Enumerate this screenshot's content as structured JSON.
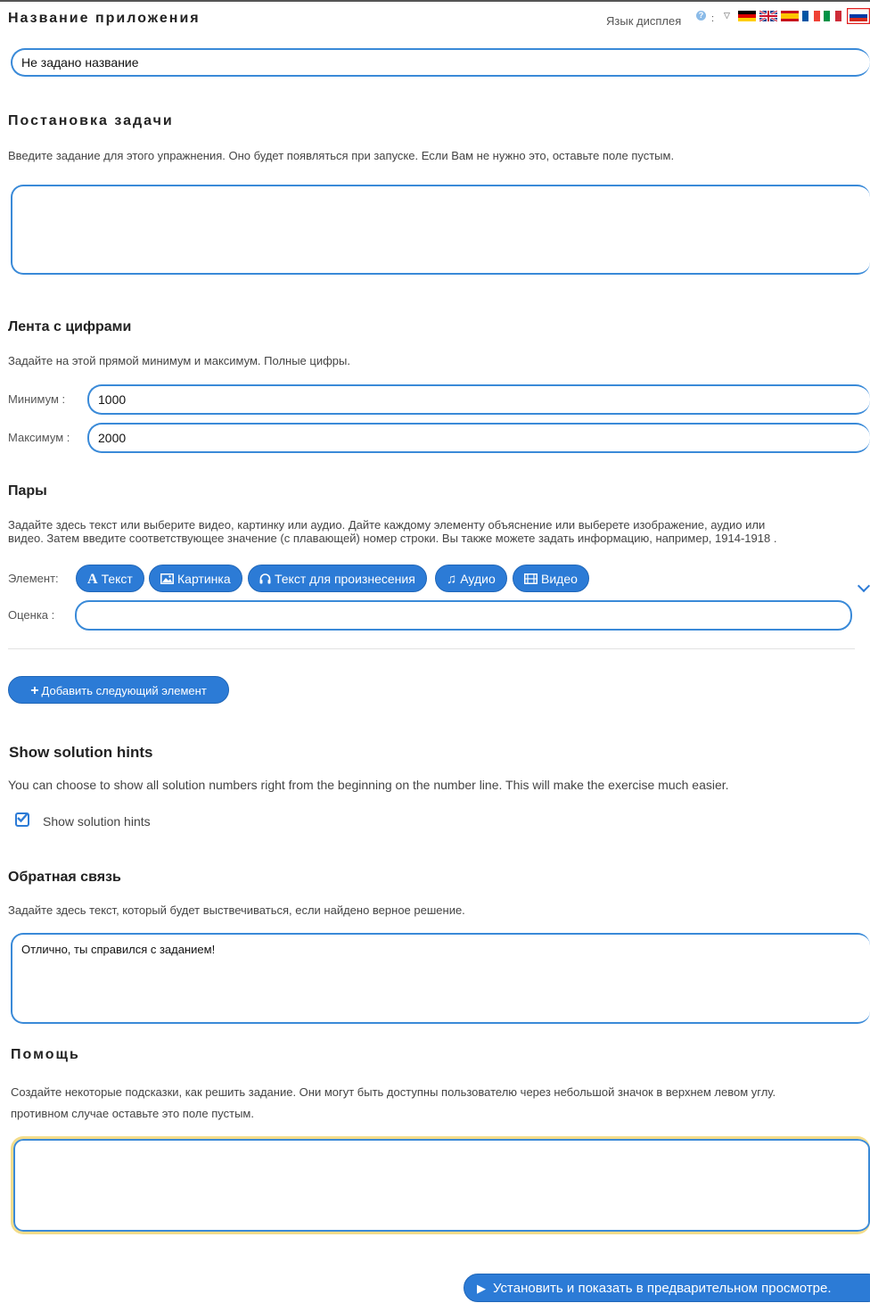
{
  "app_name": {
    "heading": "Название приложения",
    "value": "Не задано название",
    "display_language_label": "Язык дисплея",
    "help_icon": "?",
    "flags": [
      "de",
      "gb",
      "es",
      "fr",
      "it",
      "ru"
    ]
  },
  "task": {
    "heading": "Постановка задачи",
    "description": "Введите задание для этого упражнения. Оно будет появляться при запуске. Если Вам не нужно это, оставьте поле пустым.",
    "value": ""
  },
  "number_line": {
    "heading": "Лента с цифрами",
    "description": "Задайте на этой прямой минимум и максимум. Полные цифры.",
    "min_label": "Минимум :",
    "min_value": "1000",
    "max_label": "Максимум :",
    "max_value": "2000"
  },
  "pairs": {
    "heading": "Пары",
    "description_line1": "Задайте здесь текст или выберите видео, картинку или аудио. Дайте каждому элементу объяснение или выберете изображение, аудио или",
    "description_line2": "видео. Затем введите соответствующее значение (с плавающей) номер строки. Вы также можете задать информацию, например, 1914-1918 .",
    "element_label": "Элемент:",
    "buttons": {
      "text": "Текст",
      "image": "Картинка",
      "tts": "Текст для произнесения",
      "audio": "Аудио",
      "video": "Видео"
    },
    "score_label": "Оценка :",
    "score_value": "",
    "add_button": "Добавить следующий элемент"
  },
  "hints": {
    "heading": "Show solution hints",
    "description": "You can choose to show all solution numbers right from the beginning on the number line. This will make the exercise much easier.",
    "checkbox_label": "Show solution hints",
    "checked": true
  },
  "feedback": {
    "heading": "Обратная связь",
    "description": "Задайте здесь текст, который будет выствечиваться, если найдено верное решение.",
    "value": "Отлично, ты справился с заданием!"
  },
  "help": {
    "heading": "Помощь",
    "description_line1": "Создайте некоторые подсказки, как решить задание. Они могут быть доступны пользователю через небольшой значок в верхнем левом углу.",
    "description_line2": "противном случае оставьте это поле пустым.",
    "value": ""
  },
  "submit_button": "Установить и показать в предварительном просмотре.",
  "colors": {
    "accent": "#2c7bd6",
    "field_border": "#3a8ad8",
    "help_border": "#f3dc8a"
  }
}
